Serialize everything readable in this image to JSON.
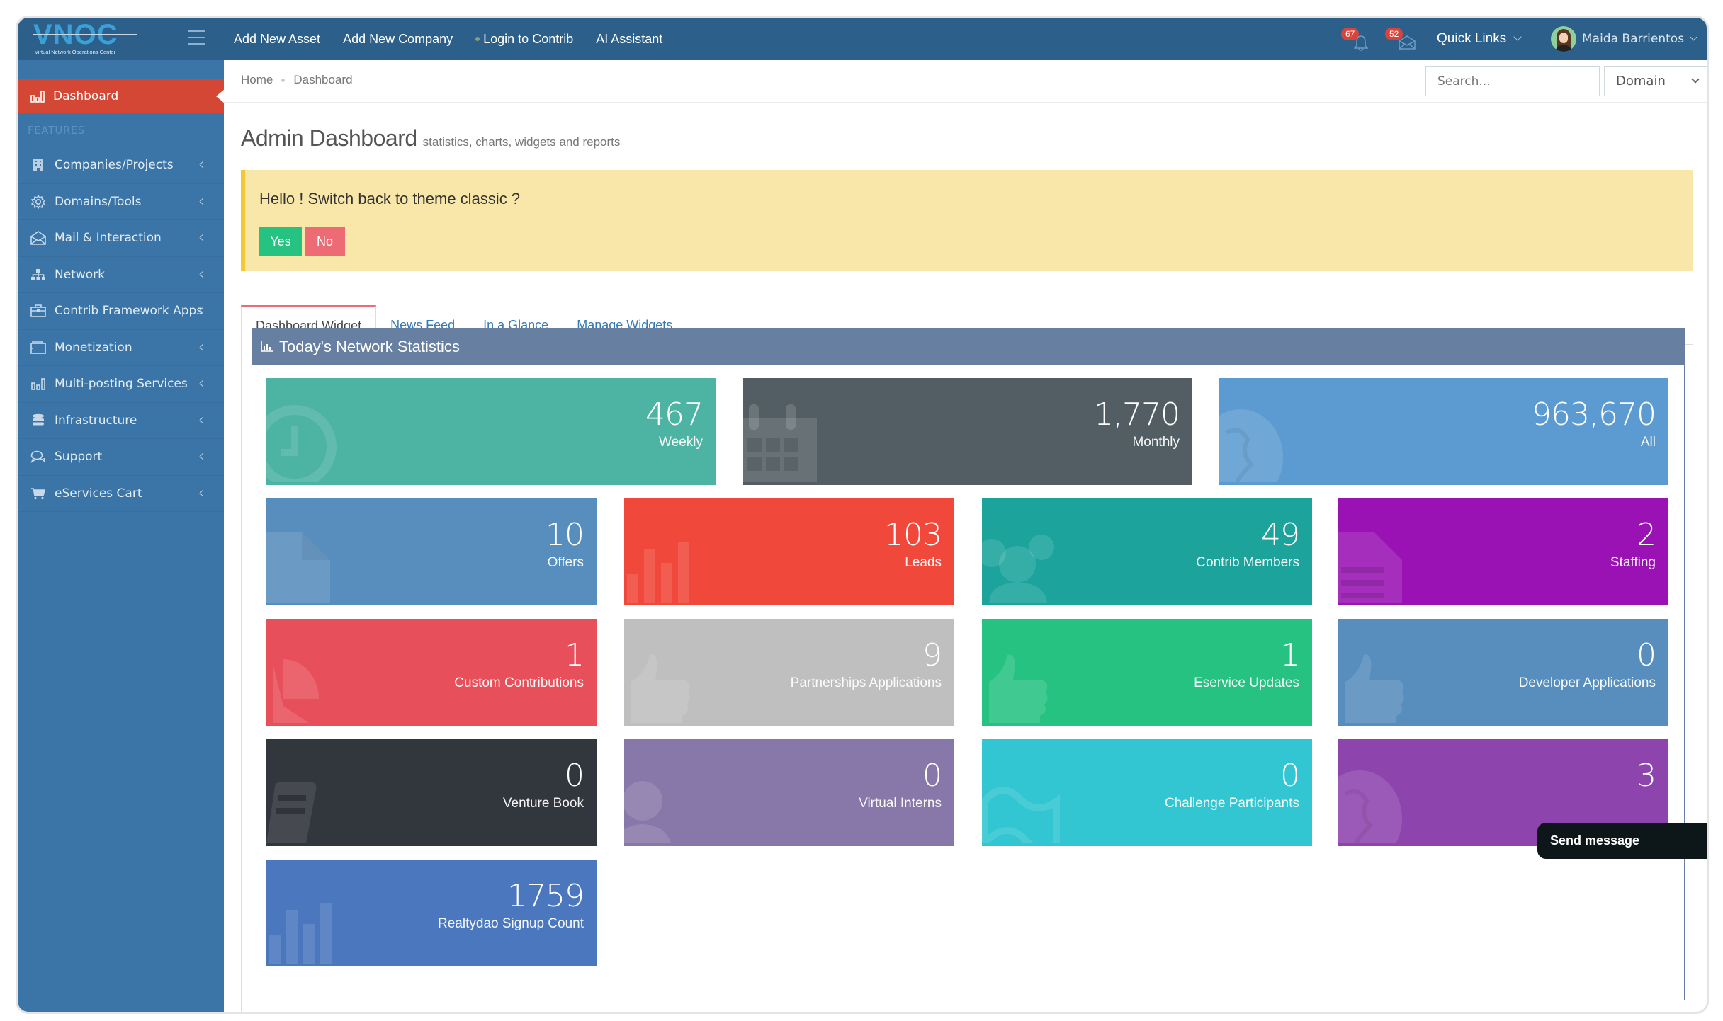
{
  "app": {
    "logo_text": "VNOC",
    "logo_subtitle": "Virtual Network Operations Center"
  },
  "topnav": {
    "links": [
      {
        "label": "Add New Asset"
      },
      {
        "label": "Add New Company"
      },
      {
        "label": "Login to Contrib"
      },
      {
        "label": "AI Assistant"
      }
    ],
    "notifications_count": "67",
    "messages_count": "52",
    "quick_links_label": "Quick Links",
    "user_name": "Maida Barrientos"
  },
  "sidebar": {
    "active": {
      "label": "Dashboard",
      "icon": "bar-chart-icon"
    },
    "section_label": "FEATURES",
    "items": [
      {
        "label": "Companies/Projects",
        "icon": "building-icon"
      },
      {
        "label": "Domains/Tools",
        "icon": "gear-icon"
      },
      {
        "label": "Mail & Interaction",
        "icon": "envelope-open-icon"
      },
      {
        "label": "Network",
        "icon": "sitemap-icon"
      },
      {
        "label": "Contrib Framework Apps",
        "icon": "briefcase-icon"
      },
      {
        "label": "Monetization",
        "icon": "wallet-icon"
      },
      {
        "label": "Multi-posting Services",
        "icon": "bar-chart-icon"
      },
      {
        "label": "Infrastructure",
        "icon": "database-icon"
      },
      {
        "label": "Support",
        "icon": "chat-icon"
      },
      {
        "label": "eServices Cart",
        "icon": "cart-icon"
      }
    ]
  },
  "breadcrumb": {
    "items": [
      "Home",
      "Dashboard"
    ]
  },
  "search": {
    "placeholder": "Search..."
  },
  "domain_select": {
    "value": "Domain"
  },
  "page": {
    "title": "Admin Dashboard",
    "subtitle": "statistics, charts, widgets and reports"
  },
  "alert": {
    "message": "Hello ! Switch back to theme classic ?",
    "yes_label": "Yes",
    "no_label": "No"
  },
  "tabs": [
    {
      "label": "Dashboard Widget",
      "active": true
    },
    {
      "label": "News Feed"
    },
    {
      "label": "In a Glance"
    },
    {
      "label": "Manage Widgets"
    }
  ],
  "panel": {
    "title": "Today's Network Statistics"
  },
  "stats": [
    {
      "value": "467",
      "label": "Weekly",
      "color": "#4db3a2",
      "icon": "clock-icon"
    },
    {
      "value": "1,770",
      "label": "Monthly",
      "color": "#525e64",
      "icon": "calendar-icon"
    },
    {
      "value": "963,670",
      "label": "All",
      "color": "#5c9bd1",
      "icon": "globe-icon"
    },
    {
      "value": "10",
      "label": "Offers",
      "color": "#578ebe",
      "icon": "file-icon"
    },
    {
      "value": "103",
      "label": "Leads",
      "color": "#f0483a",
      "icon": "bar-chart-icon"
    },
    {
      "value": "49",
      "label": "Contrib Members",
      "color": "#1ba39c",
      "icon": "users-icon"
    },
    {
      "value": "2",
      "label": "Staffing",
      "color": "#9a12b3",
      "icon": "file-text-icon"
    },
    {
      "value": "1",
      "label": "Custom Contributions",
      "color": "#e7505a",
      "icon": "pie-chart-icon"
    },
    {
      "value": "9",
      "label": "Partnerships Applications",
      "color": "#bfbfbf",
      "icon": "thumbs-up-icon"
    },
    {
      "value": "1",
      "label": "Eservice Updates",
      "color": "#26c281",
      "icon": "thumbs-up-icon"
    },
    {
      "value": "0",
      "label": "Developer Applications",
      "color": "#578ebe",
      "icon": "thumbs-up-icon"
    },
    {
      "value": "0",
      "label": "Venture Book",
      "color": "#32363d",
      "icon": "book-icon"
    },
    {
      "value": "0",
      "label": "Virtual Interns",
      "color": "#8877a9",
      "icon": "user-icon"
    },
    {
      "value": "0",
      "label": "Challenge Participants",
      "color": "#32c5d2",
      "icon": "map-icon"
    },
    {
      "value": "3",
      "label": "",
      "color": "#8e44ad",
      "icon": "globe-icon"
    },
    {
      "value": "1759",
      "label": "Realtydao Signup Count",
      "color": "#4b77be",
      "icon": "bar-chart-icon"
    }
  ],
  "chat_widget": {
    "label": "Send message"
  }
}
